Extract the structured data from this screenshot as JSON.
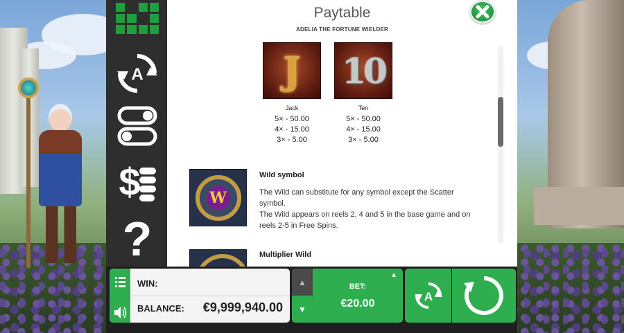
{
  "paytable": {
    "title": "Paytable",
    "subtitle": "ADELIA THE FORTUNE WIELDER",
    "symbols": [
      {
        "glyph": "J",
        "name": "Jack",
        "payouts": [
          "5× - 50.00",
          "4× - 15.00",
          "3× - 5.00"
        ]
      },
      {
        "glyph": "10",
        "name": "Ten",
        "payouts": [
          "5× - 50.00",
          "4× - 15.00",
          "3× - 5.00"
        ]
      }
    ],
    "wild": {
      "glyph": "W",
      "heading": "Wild symbol",
      "line1": "The Wild can substitute for any symbol except the Scatter symbol.",
      "line2": "The Wild appears on reels 2, 4 and 5 in the base game and on reels 2-5 in Free Spins."
    },
    "multiplier": {
      "heading": "Multiplier Wild"
    }
  },
  "menu": {
    "autoplay_glyph": "A",
    "help_glyph": "?",
    "paytable_glyph": "$"
  },
  "bottom": {
    "win_label": "WIN:",
    "win_value": "",
    "balance_label": "BALANCE:",
    "balance_value": "€9,999,940.00",
    "bet_label": "BET:",
    "bet_value": "€20.00",
    "autoplay_glyph": "A"
  },
  "colors": {
    "accent_green": "#2fae4f",
    "panel_dark": "#2e2e2e"
  },
  "icons": [
    "grid-logo-icon",
    "autoplay-icon",
    "settings-toggle-icon",
    "paytable-money-icon",
    "help-icon",
    "close-icon",
    "menu-list-icon",
    "sound-icon",
    "bet-up-icon",
    "bet-down-icon",
    "spin-icon"
  ]
}
